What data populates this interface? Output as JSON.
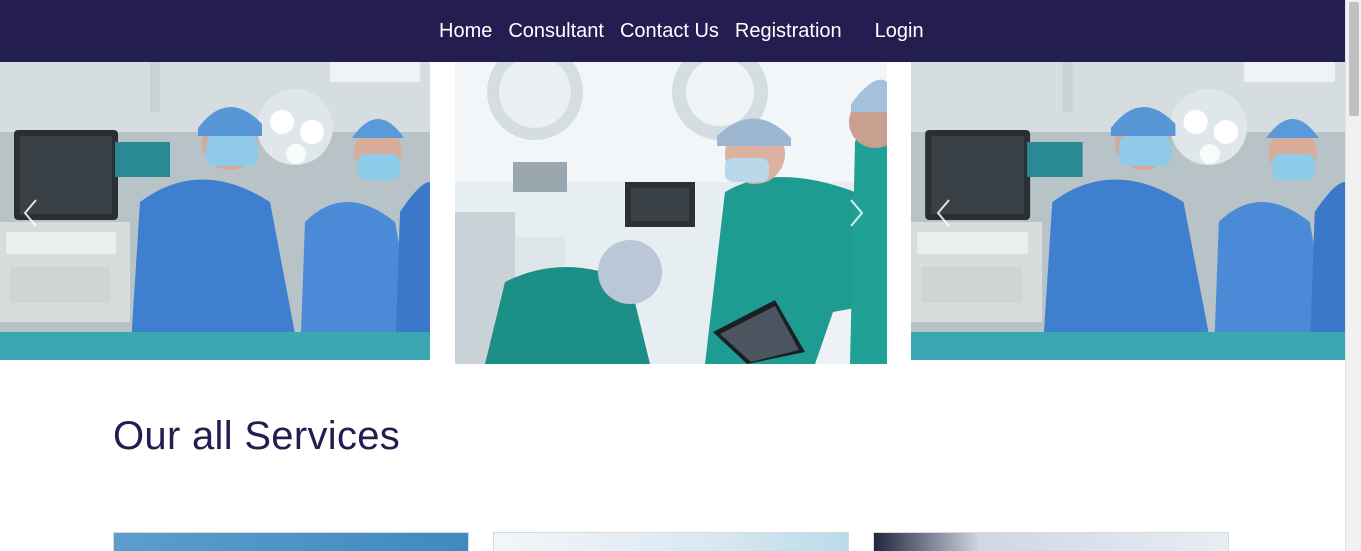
{
  "nav": {
    "items": [
      {
        "label": "Home"
      },
      {
        "label": "Consultant"
      },
      {
        "label": "Contact Us"
      },
      {
        "label": "Registration"
      },
      {
        "label": "Login"
      }
    ]
  },
  "carousel": {
    "slides": [
      {
        "image": "surgeons-in-operating-room"
      },
      {
        "image": "surgeon-with-tablet-operating"
      },
      {
        "image": "surgeons-in-operating-room"
      }
    ],
    "prev_icon": "chevron-left-icon",
    "next_icon": "chevron-right-icon"
  },
  "services": {
    "title": "Our all Services",
    "cards": [
      {
        "image": "service-image-1"
      },
      {
        "image": "service-image-2"
      },
      {
        "image": "service-image-3"
      }
    ]
  },
  "colors": {
    "navbar": "#231e4f",
    "title": "#231e4f",
    "scrub_blue": "#3f7fcf"
  }
}
